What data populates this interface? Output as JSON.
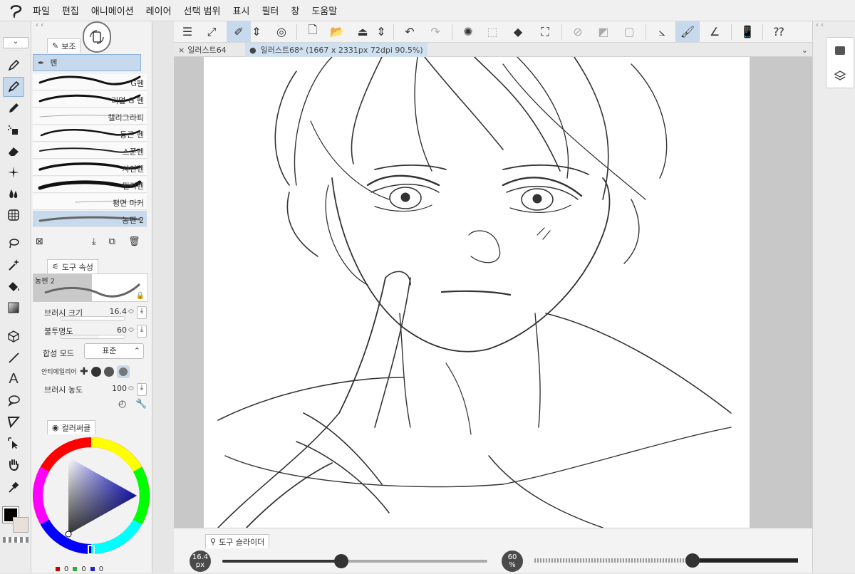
{
  "menu": [
    "파일",
    "편집",
    "애니메이션",
    "레이어",
    "선택 범위",
    "표시",
    "필터",
    "창",
    "도움말"
  ],
  "subtool_panel": {
    "tab_label": "보조",
    "group_label": "펜",
    "brushes": [
      {
        "name": "G펜"
      },
      {
        "name": "리얼 G 펜"
      },
      {
        "name": "캘리그라피"
      },
      {
        "name": "둥근 펜"
      },
      {
        "name": "스푼펜"
      },
      {
        "name": "사인펜"
      },
      {
        "name": "밀리펜"
      },
      {
        "name": "평면 마커"
      },
      {
        "name": "농펜 2"
      }
    ],
    "selected_index": 8
  },
  "tool_property": {
    "tab_label": "도구 속성",
    "preview_name": "농펜 2",
    "brush_size_label": "브러시 크기",
    "brush_size_value": "16.4",
    "opacity_label": "불투명도",
    "opacity_value": "60",
    "blend_mode_label": "합성 모드",
    "blend_mode_value": "표준",
    "antialias_label": "안티에일리어",
    "brush_density_label": "브러시 농도",
    "brush_density_value": "100"
  },
  "color_panel": {
    "tab_label": "컬러써클",
    "main_color": "#000000",
    "sub_color": "#eae0da",
    "rgb_values": [
      "0",
      "0",
      "0"
    ]
  },
  "doc_tabs": [
    {
      "label": "일러스트64",
      "active": false
    },
    {
      "label": "일러스트68* (1667 x 2331px 72dpi 90.5%)",
      "active": true
    }
  ],
  "bottom_panel": {
    "tab_label": "도구 슬라이더",
    "size_value": "16.4",
    "size_unit": "px",
    "size_fraction": 0.45,
    "opacity_value": "60",
    "opacity_unit": "%",
    "opacity_fraction": 0.6
  },
  "colors": {
    "accent": "#c7d9ec",
    "selected_border": "#8fb2d6"
  }
}
